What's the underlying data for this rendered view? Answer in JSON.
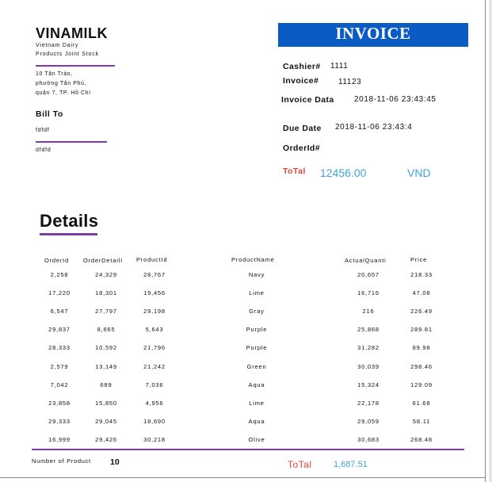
{
  "company": {
    "name": "VINAMILK",
    "sub1": "Vietnam Dairy",
    "sub2": "Products Joint Stock",
    "address": [
      "10 Tân Trào,",
      "phường Tân Phú,",
      "quận 7, TP. Hồ Chí"
    ]
  },
  "bill_to": {
    "label": "Bill To",
    "line1": "fdfdf",
    "line2": "dfdfd"
  },
  "invoice": {
    "title": "INVOICE",
    "cashier_label": "Cashier#",
    "cashier_value": "1111",
    "invoice_label": "Invoice#",
    "invoice_value": "11123",
    "data_label": "Invoice Data",
    "data_value": "2018-11-06  23:43:45",
    "due_label": "Due Date",
    "due_value": "2018-11-06  23:43:4",
    "order_label": "OrderId#",
    "order_value": "",
    "total_label": "ToTal",
    "total_value": "12456.00",
    "currency": "VND"
  },
  "details_title": "Details",
  "table": {
    "headers": [
      "OrderId",
      "OrderDetailI",
      "ProductId",
      "ProductName",
      "ActualQuanti",
      "Price"
    ],
    "rows": [
      [
        "2,258",
        "24,329",
        "28,767",
        "Navy",
        "20,657",
        "218.33"
      ],
      [
        "17,220",
        "18,301",
        "19,456",
        "Lime",
        "16,716",
        "47.08"
      ],
      [
        "6,547",
        "27,797",
        "29,198",
        "Gray",
        "216",
        "226.49"
      ],
      [
        "29,837",
        "8,665",
        "5,643",
        "Purple",
        "25,868",
        "289.81"
      ],
      [
        "28,333",
        "10,592",
        "21,796",
        "Purple",
        "31,282",
        "89.98"
      ],
      [
        "2,579",
        "13,149",
        "21,242",
        "Green",
        "30,039",
        "298.46"
      ],
      [
        "7,042",
        "689",
        "7,036",
        "Aqua",
        "15,324",
        "129.09"
      ],
      [
        "23,858",
        "15,850",
        "4,956",
        "Lime",
        "22,178",
        "61.68"
      ],
      [
        "29,333",
        "29,045",
        "18,690",
        "Aqua",
        "29,059",
        "58.11"
      ],
      [
        "16,999",
        "29,426",
        "30,218",
        "Olive",
        "30,683",
        "268.48"
      ]
    ]
  },
  "footer": {
    "count_label": "Number of Product",
    "count_value": "10",
    "total_label": "ToTal",
    "total_value": "1,687.51"
  },
  "colors": {
    "banner": "#0a5cc4",
    "accent_line": "#7b3fa0",
    "total_label": "#e0453a",
    "total_value": "#3fa3d8"
  }
}
